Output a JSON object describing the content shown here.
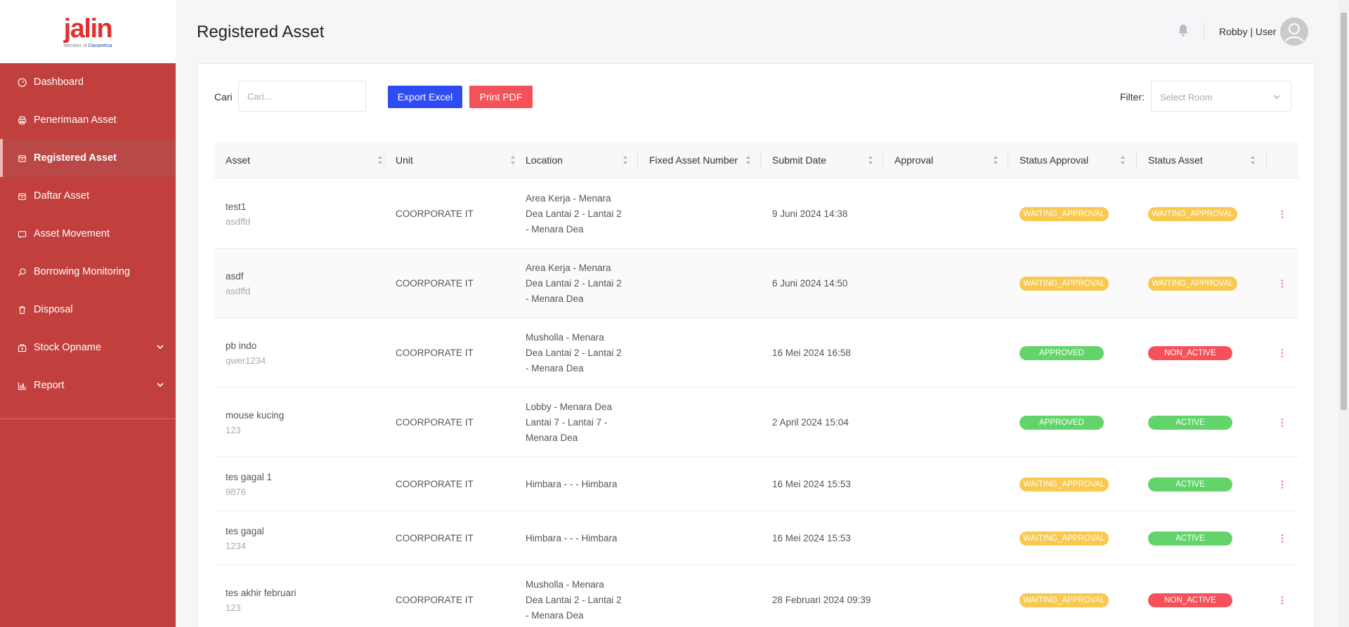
{
  "brand": {
    "logo_text": "jalin",
    "sub_prefix": "Member of",
    "sub_name": "Danareksa"
  },
  "sidebar": {
    "items": [
      {
        "label": "Dashboard",
        "icon": "dashboard-icon"
      },
      {
        "label": "Penerimaan Asset",
        "icon": "printer-icon"
      },
      {
        "label": "Registered Asset",
        "icon": "box-icon",
        "active": true
      },
      {
        "label": "Daftar Asset",
        "icon": "box-icon"
      },
      {
        "label": "Asset Movement",
        "icon": "move-icon"
      },
      {
        "label": "Borrowing Monitoring",
        "icon": "search-icon"
      },
      {
        "label": "Disposal",
        "icon": "trash-icon"
      },
      {
        "label": "Stock Opname",
        "icon": "stock-icon",
        "expandable": true
      },
      {
        "label": "Report",
        "icon": "chart-icon",
        "expandable": true
      }
    ]
  },
  "header": {
    "title": "Registered Asset",
    "user": "Robby | User"
  },
  "toolbar": {
    "search_label": "Cari",
    "search_placeholder": "Cari...",
    "export_label": "Export Excel",
    "print_label": "Print PDF",
    "filter_label": "Filter:",
    "filter_placeholder": "Select Room"
  },
  "table": {
    "columns": [
      "Asset",
      "Unit",
      "Location",
      "Fixed Asset Number",
      "Submit Date",
      "Approval",
      "Status Approval",
      "Status Asset"
    ],
    "rows": [
      {
        "asset": "test1",
        "code": "asdffd",
        "unit": "COORPORATE IT",
        "location": [
          "Area Kerja - Menara",
          "Dea Lantai 2 - Lantai 2",
          "- Menara Dea"
        ],
        "fixed_asset_number": "",
        "submit_date": "9 Juni 2024 14:38",
        "approval": "",
        "status_approval": "WAITING_APPROVAL",
        "status_asset": "WAITING_APPROVAL"
      },
      {
        "asset": "asdf",
        "code": "asdffd",
        "unit": "COORPORATE IT",
        "location": [
          "Area Kerja - Menara",
          "Dea Lantai 2 - Lantai 2",
          "- Menara Dea"
        ],
        "fixed_asset_number": "",
        "submit_date": "6 Juni 2024 14:50",
        "approval": "",
        "status_approval": "WAITING_APPROVAL",
        "status_asset": "WAITING_APPROVAL"
      },
      {
        "asset": "pb indo",
        "code": "qwer1234",
        "unit": "COORPORATE IT",
        "location": [
          "Musholla - Menara",
          "Dea Lantai 2 - Lantai 2",
          "- Menara Dea"
        ],
        "fixed_asset_number": "",
        "submit_date": "16 Mei 2024 16:58",
        "approval": "",
        "status_approval": "APPROVED",
        "status_asset": "NON_ACTIVE"
      },
      {
        "asset": "mouse kucing",
        "code": "123",
        "unit": "COORPORATE IT",
        "location": [
          "Lobby - Menara Dea",
          "Lantai 7 - Lantai 7 -",
          "Menara Dea"
        ],
        "fixed_asset_number": "",
        "submit_date": "2 April 2024 15:04",
        "approval": "",
        "status_approval": "APPROVED",
        "status_asset": "ACTIVE"
      },
      {
        "asset": "tes gagal 1",
        "code": "9876",
        "unit": "COORPORATE IT",
        "location": [
          "Himbara - - - Himbara"
        ],
        "fixed_asset_number": "",
        "submit_date": "16 Mei 2024 15:53",
        "approval": "",
        "status_approval": "WAITING_APPROVAL",
        "status_asset": "ACTIVE"
      },
      {
        "asset": "tes gagal",
        "code": "1234",
        "unit": "COORPORATE IT",
        "location": [
          "Himbara - - - Himbara"
        ],
        "fixed_asset_number": "",
        "submit_date": "16 Mei 2024 15:53",
        "approval": "",
        "status_approval": "WAITING_APPROVAL",
        "status_asset": "ACTIVE"
      },
      {
        "asset": "tes akhir februari",
        "code": "123",
        "unit": "COORPORATE IT",
        "location": [
          "Musholla - Menara",
          "Dea Lantai 2 - Lantai 2",
          "- Menara Dea"
        ],
        "fixed_asset_number": "",
        "submit_date": "28 Februari 2024 09:39",
        "approval": "",
        "status_approval": "WAITING_APPROVAL",
        "status_asset": "NON_ACTIVE"
      }
    ]
  },
  "colors": {
    "sidebar": "#c13f3d",
    "brand_red": "#e2302f",
    "primary_button": "#2e4bf4",
    "danger_button": "#f5515a",
    "waiting": "#f9c84e",
    "success": "#63d46a",
    "danger": "#f5515a"
  }
}
